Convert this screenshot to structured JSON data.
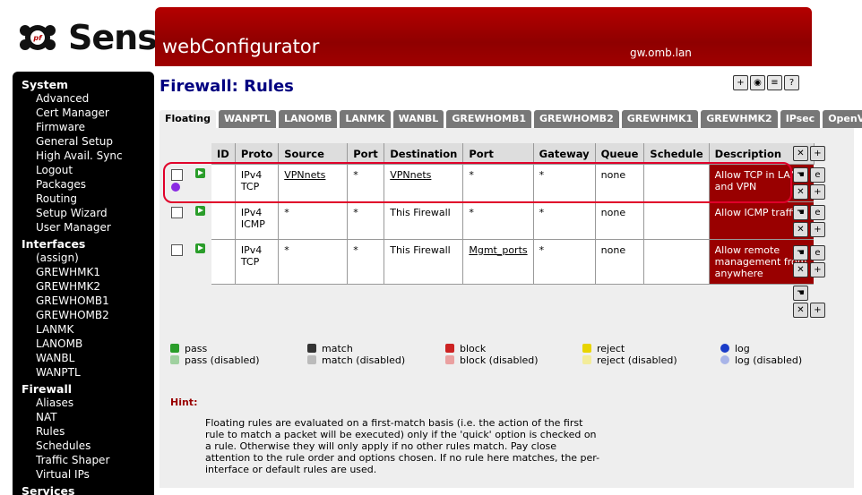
{
  "brand": {
    "logo_text": "Sense",
    "logo_mark": "pf"
  },
  "header": {
    "title": "webConfigurator",
    "hostname": "gw.omb.lan"
  },
  "sidebar": {
    "sections": [
      {
        "title": "System",
        "items": [
          "Advanced",
          "Cert Manager",
          "Firmware",
          "General Setup",
          "High Avail. Sync",
          "Logout",
          "Packages",
          "Routing",
          "Setup Wizard",
          "User Manager"
        ]
      },
      {
        "title": "Interfaces",
        "items": [
          "(assign)",
          "GREWHMK1",
          "GREWHMK2",
          "GREWHOMB1",
          "GREWHOMB2",
          "LANMK",
          "LANOMB",
          "WANBL",
          "WANPTL"
        ]
      },
      {
        "title": "Firewall",
        "items": [
          "Aliases",
          "NAT",
          "Rules",
          "Schedules",
          "Traffic Shaper",
          "Virtual IPs"
        ]
      },
      {
        "title": "Services",
        "items": []
      }
    ]
  },
  "page": {
    "title": "Firewall: Rules"
  },
  "tabs": [
    "Floating",
    "WANPTL",
    "LANOMB",
    "LANMK",
    "WANBL",
    "GREWHOMB1",
    "GREWHOMB2",
    "GREWHMK1",
    "GREWHMK2",
    "IPsec",
    "OpenVPN"
  ],
  "table": {
    "headers": [
      "ID",
      "Proto",
      "Source",
      "Port",
      "Destination",
      "Port",
      "Gateway",
      "Queue",
      "Schedule",
      "Description"
    ],
    "rows": [
      {
        "id": "",
        "proto": "IPv4\nTCP",
        "source": "VPNnets",
        "sport": "*",
        "destination": "VPNnets",
        "dport": "*",
        "gateway": "*",
        "queue": "none",
        "schedule": "",
        "description": "Allow TCP in LAN and VPN"
      },
      {
        "id": "",
        "proto": "IPv4\nICMP",
        "source": "*",
        "sport": "*",
        "destination": "This Firewall",
        "dport": "*",
        "gateway": "*",
        "queue": "none",
        "schedule": "",
        "description": "Allow ICMP traffic"
      },
      {
        "id": "",
        "proto": "IPv4\nTCP",
        "source": "*",
        "sport": "*",
        "destination": "This Firewall",
        "dport": "Mgmt_ports",
        "gateway": "*",
        "queue": "none",
        "schedule": "",
        "description": "Allow remote management from anywhere"
      }
    ]
  },
  "legend": [
    {
      "label": "pass",
      "label_disabled": "pass (disabled)",
      "color": "#2a9d2a"
    },
    {
      "label": "match",
      "label_disabled": "match (disabled)",
      "color": "#333333"
    },
    {
      "label": "block",
      "label_disabled": "block (disabled)",
      "color": "#cc2222"
    },
    {
      "label": "reject",
      "label_disabled": "reject (disabled)",
      "color": "#e8d400"
    },
    {
      "label": "log",
      "label_disabled": "log (disabled)",
      "color": "#1a3cc8"
    }
  ],
  "hint": {
    "label": "Hint:",
    "text": "Floating rules are evaluated on a first-match basis (i.e. the action of the first rule to match a packet will be executed) only if the 'quick' option is checked on a rule. Otherwise they will only apply if no other rules match. Pay close attention to the rule order and options chosen. If no rule here matches, the per-interface or default rules are used."
  },
  "colors": {
    "accent": "#990000",
    "header": "#a00000",
    "title": "#000080"
  }
}
